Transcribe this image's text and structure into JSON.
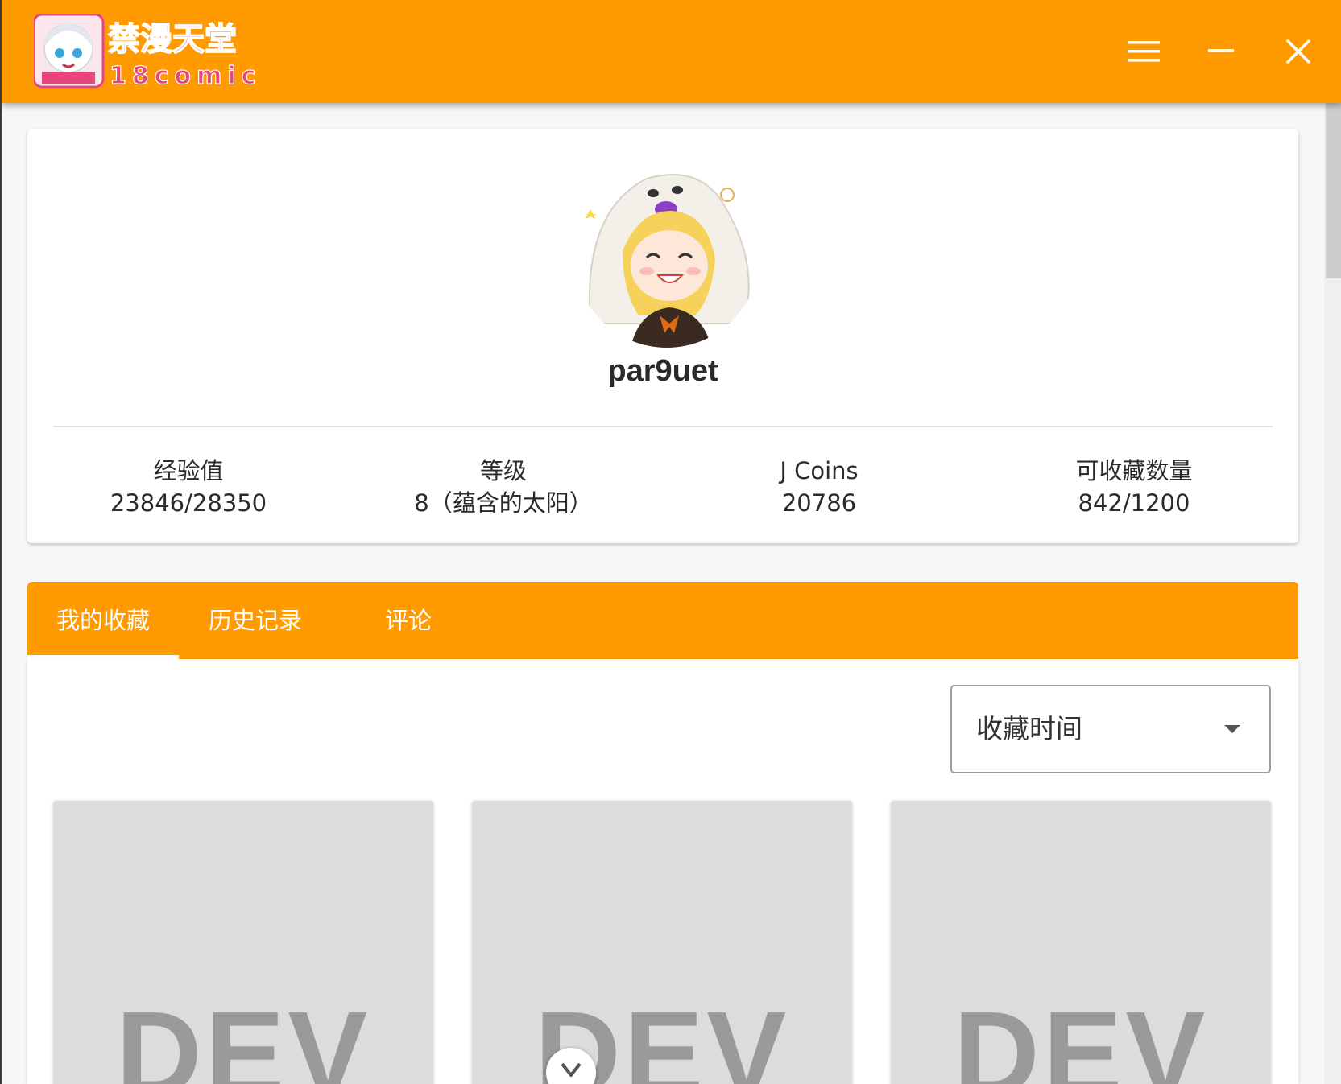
{
  "app": {
    "logo_title": "禁漫天堂",
    "logo_subtitle": "18comic"
  },
  "titlebar": {
    "menu_icon": "hamburger-menu-icon",
    "minimize_icon": "minimize-icon",
    "close_icon": "close-icon"
  },
  "profile": {
    "username": "par9uet",
    "stats": [
      {
        "label": "经验值",
        "value": "23846/28350"
      },
      {
        "label": "等级",
        "value": "8（蕴含的太阳）"
      },
      {
        "label": "J Coins",
        "value": "20786"
      },
      {
        "label": "可收藏数量",
        "value": "842/1200"
      }
    ]
  },
  "tabs": [
    {
      "label": "我的收藏",
      "active": true
    },
    {
      "label": "历史记录",
      "active": false
    },
    {
      "label": "评论",
      "active": false
    }
  ],
  "sort": {
    "selected": "收藏时间"
  },
  "covers": [
    {
      "text": "DEV"
    },
    {
      "text": "DEV"
    },
    {
      "text": "DEV"
    }
  ],
  "colors": {
    "accent": "#ff9a00",
    "cover_placeholder": "#dcdcdc"
  }
}
